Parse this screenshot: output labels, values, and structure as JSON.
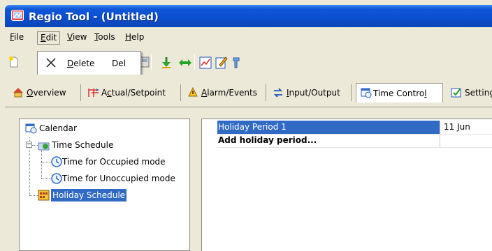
{
  "window": {
    "title": "Regio Tool - (Untitled)"
  },
  "menubar": {
    "items": [
      {
        "label": "File",
        "key": "F",
        "rest": "ile"
      },
      {
        "label": "Edit",
        "key": "E",
        "rest": "dit"
      },
      {
        "label": "View",
        "key": "V",
        "rest": "iew"
      },
      {
        "label": "Tools",
        "key": "T",
        "rest": "ools"
      },
      {
        "label": "Help",
        "key": "H",
        "rest": "elp"
      }
    ]
  },
  "edit_menu": {
    "items": [
      {
        "label": "Delete",
        "key": "D",
        "rest": "elete",
        "shortcut": "Del"
      }
    ]
  },
  "tabs": [
    {
      "label": "Overview",
      "key": "O",
      "rest": "verview"
    },
    {
      "label": "Actual/Setpoint",
      "pre": "A",
      "key": "c",
      "rest": "tual/Setpoint"
    },
    {
      "label": "Alarm/Events",
      "key": "A",
      "rest": "larm/Events"
    },
    {
      "label": "Input/Output",
      "key": "I",
      "rest": "nput/Output"
    },
    {
      "label": "Time Control",
      "pre": "Time Contro",
      "key": "l",
      "rest": ""
    },
    {
      "label": "Settings",
      "pre": "Setting",
      "key": "",
      "rest": ""
    }
  ],
  "tree": {
    "calendar": "Calendar",
    "time_schedule": "Time Schedule",
    "occupied": "Time for Occupied mode",
    "unoccupied": "Time for Unoccupied mode",
    "holiday": "Holiday Schedule",
    "expander": "−"
  },
  "holiday_list": {
    "rows": [
      {
        "name": "Holiday Period 1",
        "date": "11 Jun"
      }
    ],
    "add_label": "Add holiday period..."
  }
}
